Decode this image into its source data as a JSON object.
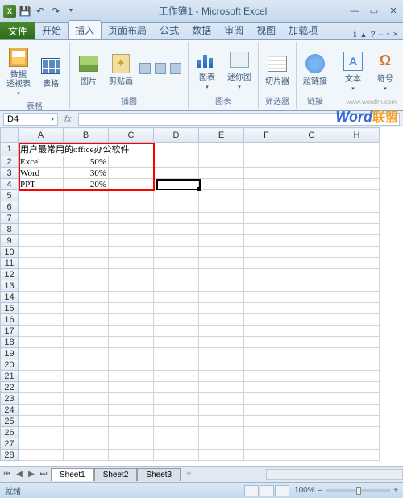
{
  "titlebar": {
    "title": "工作簿1 - Microsoft Excel"
  },
  "tabs": {
    "file": "文件",
    "items": [
      "开始",
      "插入",
      "页面布局",
      "公式",
      "数据",
      "审阅",
      "视图",
      "加载项"
    ],
    "active": "插入"
  },
  "ribbon": {
    "groups": {
      "tables": {
        "label": "表格",
        "pivot": "数据\n透视表",
        "table": "表格"
      },
      "illus": {
        "label": "插图",
        "pic": "图片",
        "clip": "剪贴画"
      },
      "charts": {
        "label": "图表",
        "chart": "图表",
        "spark": "迷你图"
      },
      "filter": {
        "label": "筛选器",
        "slicer": "切片器"
      },
      "links": {
        "label": "链接",
        "hyper": "超链接"
      },
      "text": {
        "text": "文本",
        "symbol": "符号"
      }
    }
  },
  "namebox": {
    "value": "D4"
  },
  "fx": "fx",
  "columns": [
    "A",
    "B",
    "C",
    "D",
    "E",
    "F",
    "G",
    "H"
  ],
  "rows": [
    "1",
    "2",
    "3",
    "4",
    "5",
    "6",
    "7",
    "8",
    "9",
    "10",
    "11",
    "12",
    "13",
    "14",
    "15",
    "16",
    "17",
    "18",
    "19",
    "20",
    "21",
    "22",
    "23",
    "24",
    "25",
    "26",
    "27",
    "28"
  ],
  "cells": {
    "A1": "用户最常用的office办公软件",
    "A2": "Excel",
    "B2": "50%",
    "A3": "Word",
    "B3": "30%",
    "A4": "PPT",
    "B4": "20%"
  },
  "sheets": {
    "items": [
      "Sheet1",
      "Sheet2",
      "Sheet3"
    ],
    "active": "Sheet1"
  },
  "status": {
    "ready": "就绪",
    "zoom": "100%"
  },
  "watermark": {
    "brand_latin": "Word",
    "brand_cn": "联盟",
    "url": "www.wordlm.com"
  },
  "chart_data": {
    "type": "table",
    "title": "用户最常用的office办公软件",
    "categories": [
      "Excel",
      "Word",
      "PPT"
    ],
    "values": [
      0.5,
      0.3,
      0.2
    ]
  }
}
